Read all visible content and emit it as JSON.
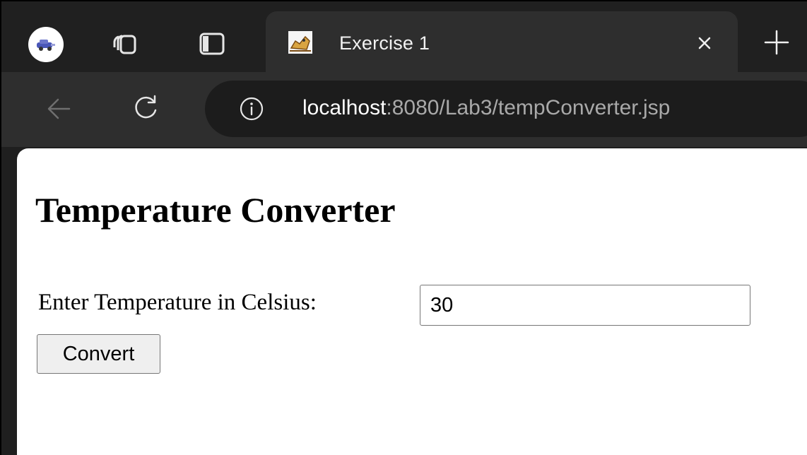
{
  "browser": {
    "tab": {
      "title": "Exercise 1",
      "favicon": "tomcat-icon"
    },
    "address_bar": {
      "host": "localhost",
      "rest": ":8080/Lab3/tempConverter.jsp"
    },
    "icons": {
      "profile": "profile-avatar-icon",
      "workspaces": "workspaces-icon",
      "tab_actions": "tab-actions-icon",
      "close": "close-icon",
      "new_tab": "plus-icon",
      "back": "arrow-left-icon",
      "reload": "reload-icon",
      "site_info": "info-icon"
    },
    "colors": {
      "tabstrip_bg": "#202020",
      "active_tab_bg": "#2e2e2e",
      "addressbar_bg": "#1c1c1c",
      "url_host": "#ffffff",
      "url_rest": "#a9a9a9"
    }
  },
  "page": {
    "heading": "Temperature Converter",
    "form": {
      "label": "Enter Temperature in Celsius:",
      "input_value": "30",
      "button_label": "Convert"
    }
  }
}
